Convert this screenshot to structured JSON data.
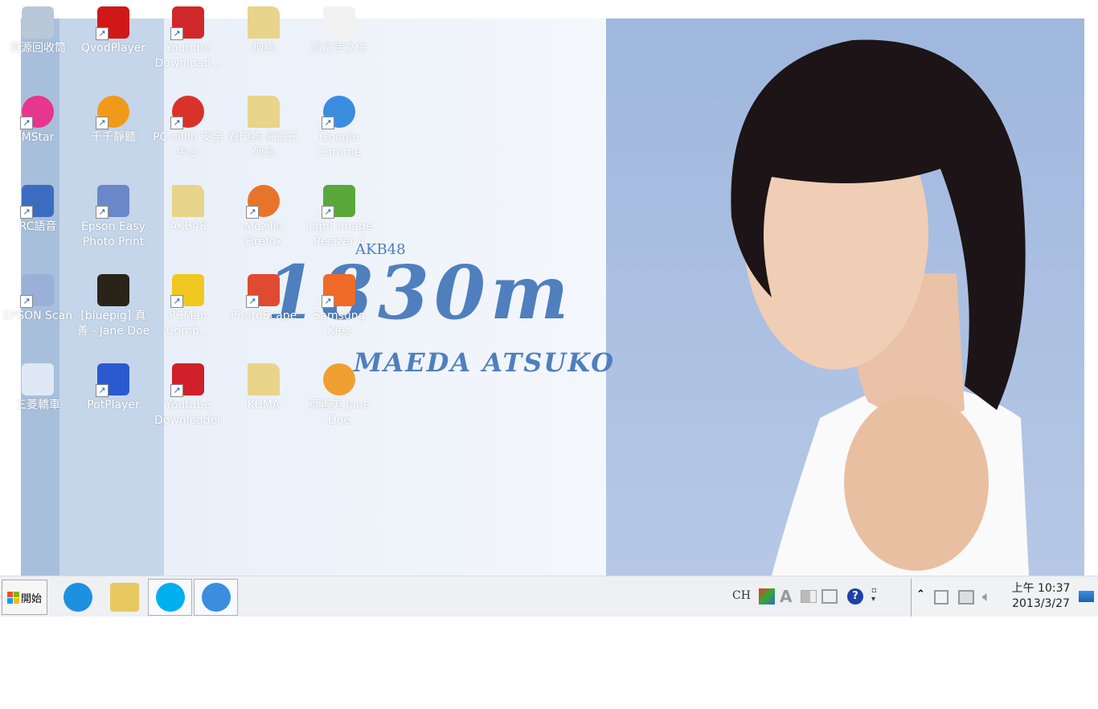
{
  "desktop": {
    "wallpaper": {
      "logo_small": "AKB48",
      "logo_title": "1830m",
      "logo_subtitle": "MAEDA ATSUKO"
    },
    "icons": [
      {
        "label": "資源回收筒",
        "icon": "recycle-bin-icon",
        "color": "#b8c8d8"
      },
      {
        "label": "QvodPlayer",
        "icon": "qvod-icon",
        "color": "#d01818"
      },
      {
        "label": "Youtube Download...",
        "icon": "youtube-downloader-icon",
        "color": "#d0282a"
      },
      {
        "label": "狗狗",
        "icon": "folder-icon",
        "color": "#e8d48a"
      },
      {
        "label": "新文字文件",
        "icon": "text-file-icon",
        "color": "#f2f2f2"
      },
      {
        "label": "MStar",
        "icon": "mstar-icon",
        "color": "#e8358e"
      },
      {
        "label": "千千靜聽",
        "icon": "ttplayer-icon",
        "color": "#f19a1a"
      },
      {
        "label": "PC-cillin 安全中心",
        "icon": "pccillin-icon",
        "color": "#d8322a"
      },
      {
        "label": "看門狗 海賊王 列島",
        "icon": "folder-icon",
        "color": "#e8d48a"
      },
      {
        "label": "Google Chrome",
        "icon": "chrome-icon",
        "color": "#3b8de0"
      },
      {
        "label": "RC語音",
        "icon": "rc-icon",
        "color": "#3c6cc0"
      },
      {
        "label": "Epson Easy Photo Print",
        "icon": "epson-photo-icon",
        "color": "#6a88c8"
      },
      {
        "label": "AKB48",
        "icon": "folder-icon",
        "color": "#e8d48a"
      },
      {
        "label": "Mozilla Firefox",
        "icon": "firefox-icon",
        "color": "#e8742a"
      },
      {
        "label": "Light Image Resizer 4",
        "icon": "resizer-icon",
        "color": "#5aa83a"
      },
      {
        "label": "EPSON Scan",
        "icon": "scanner-icon",
        "color": "#9ab0d8"
      },
      {
        "label": "[bluepig] 真善 - Jane Doe",
        "icon": "video-file-icon",
        "color": "#2a2418"
      },
      {
        "label": "PCMan Comb...",
        "icon": "pcman-icon",
        "color": "#f0c820"
      },
      {
        "label": "PhotoScape",
        "icon": "photoscape-icon",
        "color": "#e04a30"
      },
      {
        "label": "Samsung Kies",
        "icon": "kies-icon",
        "color": "#f06a28"
      },
      {
        "label": "三菱轎車",
        "icon": "word-doc-icon",
        "color": "#dfe8f5"
      },
      {
        "label": "PotPlayer",
        "icon": "potplayer-icon",
        "color": "#2a5ad0"
      },
      {
        "label": "Youtube Downloader",
        "icon": "yd-icon",
        "color": "#d0202a"
      },
      {
        "label": "KUMA",
        "icon": "folder-icon",
        "color": "#e8d48a"
      },
      {
        "label": "真善美 Jane Doe",
        "icon": "audio-file-icon",
        "color": "#f0a030"
      }
    ]
  },
  "taskbar": {
    "start_label": "開始",
    "pinned": [
      {
        "name": "internet-explorer",
        "icon": "ie-icon",
        "color": "#1e90e0"
      },
      {
        "name": "file-explorer",
        "icon": "folder-icon",
        "color": "#e8c860"
      },
      {
        "name": "skype",
        "icon": "skype-icon",
        "color": "#00aff0"
      },
      {
        "name": "chrome",
        "icon": "chrome-icon",
        "color": "#3b8de0"
      }
    ],
    "language": "CH",
    "clock": {
      "time": "上午 10:37",
      "date": "2013/3/27"
    }
  }
}
